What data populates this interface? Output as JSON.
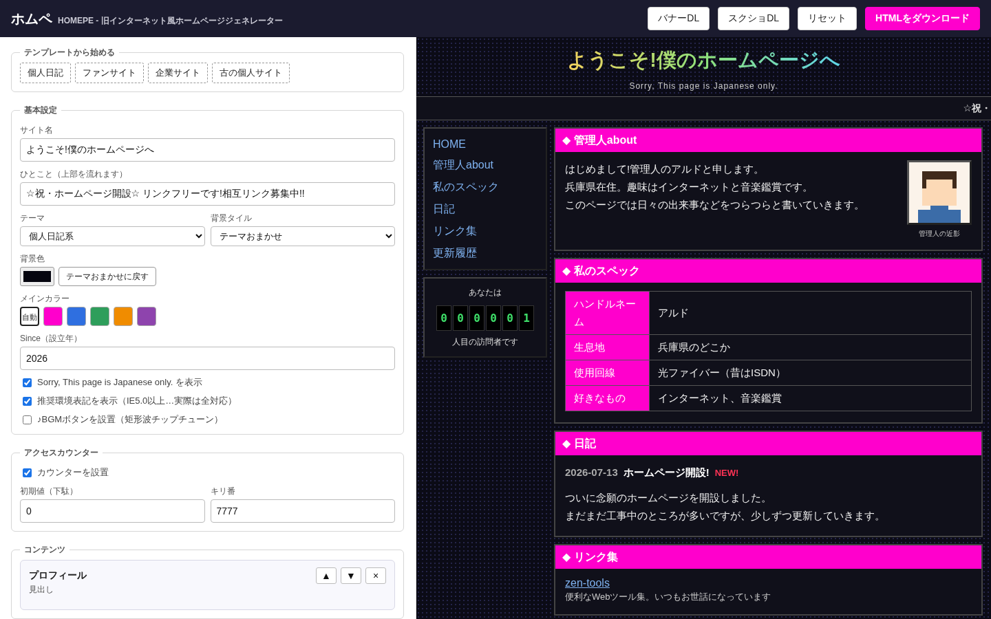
{
  "header": {
    "logo": "ホムペ",
    "subtitle": "HOMEPE - 旧インターネット風ホームページジェネレーター",
    "buttons": [
      {
        "label": "バナーDL",
        "kind": "plain"
      },
      {
        "label": "スクショDL",
        "kind": "plain"
      },
      {
        "label": "リセット",
        "kind": "plain"
      },
      {
        "label": "HTMLをダウンロード",
        "kind": "primary"
      }
    ]
  },
  "editor": {
    "sections": [
      {
        "legend": "テンプレートから始める",
        "items": [
          {
            "kind": "chips",
            "chips": [
              "個人日記",
              "ファンサイト",
              "企業サイト",
              "古の個人サイト"
            ]
          }
        ]
      },
      {
        "legend": "基本設定",
        "items": [
          {
            "kind": "text",
            "label": "サイト名",
            "value": "ようこそ!僕のホームページへ"
          },
          {
            "kind": "text",
            "label": "ひとこと（上部を流れます）",
            "value": "☆祝・ホームページ開設☆ リンクフリーです!相互リンク募集中!!"
          },
          {
            "kind": "pair",
            "fields": [
              {
                "kind": "select",
                "label": "テーマ",
                "value": "個人日記系"
              },
              {
                "kind": "select",
                "label": "背景タイル",
                "value": "テーマおまかせ"
              }
            ]
          },
          {
            "kind": "color",
            "label": "背景色",
            "color": "#05050f",
            "button": "テーマおまかせに戻す"
          },
          {
            "kind": "swatches",
            "label": "メインカラー",
            "swatches": [
              {
                "label": "自動",
                "selected": true
              },
              {
                "color": "#ff00cc",
                "selected": false
              },
              {
                "color": "#2f6fe0",
                "selected": false
              },
              {
                "color": "#2e9e5b",
                "selected": false
              },
              {
                "color": "#f08c00",
                "selected": false
              },
              {
                "color": "#8e44ad",
                "selected": false
              }
            ]
          },
          {
            "kind": "text",
            "label": "Since（設立年）",
            "value": "2026"
          },
          {
            "kind": "check",
            "label": "Sorry, This page is Japanese only. を表示",
            "checked": true
          },
          {
            "kind": "check",
            "label": "推奨環境表記を表示（IE5.0以上…実際は全対応）",
            "checked": true
          },
          {
            "kind": "check",
            "label": "♪BGMボタンを設置（矩形波チップチューン）",
            "checked": false
          }
        ]
      },
      {
        "legend": "アクセスカウンター",
        "items": [
          {
            "kind": "check",
            "label": "カウンターを設置",
            "checked": true
          },
          {
            "kind": "pair",
            "fields": [
              {
                "kind": "text",
                "label": "初期値（下駄）",
                "value": "0"
              },
              {
                "kind": "text",
                "label": "キリ番",
                "value": "7777"
              }
            ]
          }
        ]
      },
      {
        "legend": "コンテンツ",
        "items": [
          {
            "kind": "block",
            "title": "プロフィール",
            "controls": [
              "▲",
              "▼",
              "×"
            ],
            "field_label": "見出し"
          }
        ]
      }
    ]
  },
  "preview": {
    "title": "ようこそ!僕のホームページへ",
    "notice": "Sorry, This page is Japanese only.",
    "marquee": "☆祝・",
    "nav": [
      {
        "label": "HOME"
      },
      {
        "label": "管理人about"
      },
      {
        "label": "私のスペック"
      },
      {
        "label": "日記"
      },
      {
        "label": "リンク集"
      },
      {
        "label": "更新履歴"
      }
    ],
    "counter": {
      "before": "あなたは",
      "digits": [
        "0",
        "0",
        "0",
        "0",
        "0",
        "1"
      ],
      "after": "人目の訪問者です"
    },
    "sections": [
      {
        "kind": "about",
        "heading": "◆ 管理人about",
        "lines": [
          "はじめまして!管理人のアルドと申します。",
          "兵庫県在住。趣味はインターネットと音楽鑑賞です。",
          "このページでは日々の出来事などをつらつらと書いていきます。"
        ],
        "caption": "管理人の近影"
      },
      {
        "kind": "table",
        "heading": "◆ 私のスペック",
        "rows": [
          {
            "key": "ハンドルネーム",
            "value": "アルド"
          },
          {
            "key": "生息地",
            "value": "兵庫県のどこか"
          },
          {
            "key": "使用回線",
            "value": "光ファイバー（昔はISDN）"
          },
          {
            "key": "好きなもの",
            "value": "インターネット、音楽鑑賞"
          }
        ]
      },
      {
        "kind": "diary",
        "heading": "◆ 日記",
        "date": "2026-07-13",
        "title": "ホームページ開設!",
        "badge": "NEW!",
        "lines": [
          "ついに念願のホームページを開設しました。",
          "まだまだ工事中のところが多いですが、少しずつ更新していきます。"
        ]
      },
      {
        "kind": "links",
        "heading": "◆ リンク集",
        "links": [
          {
            "text": "zen-tools",
            "desc": "便利なWebツール集。いつもお世話になっています"
          }
        ]
      }
    ]
  }
}
